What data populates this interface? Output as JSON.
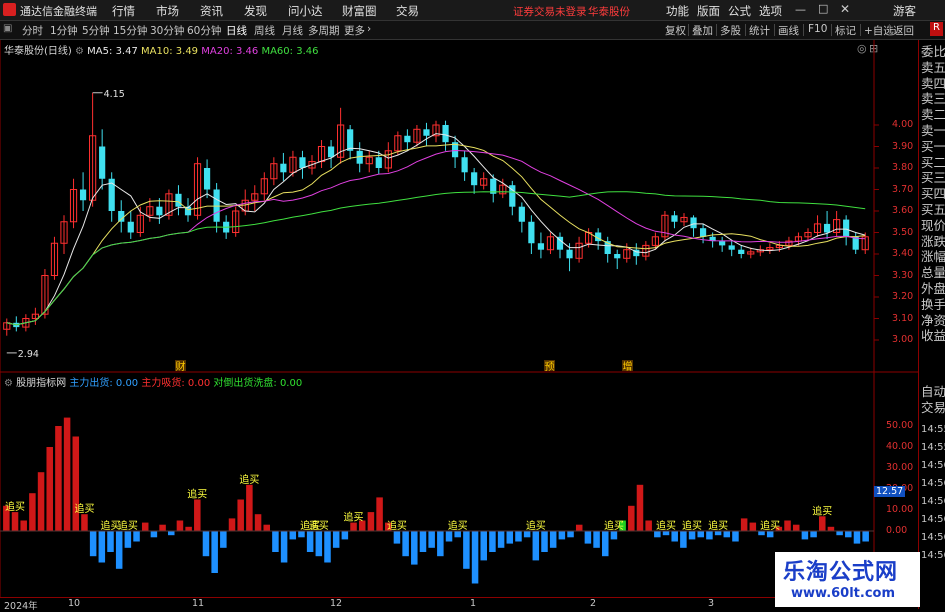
{
  "menubar": {
    "app_title": "通达信金融终端",
    "items": [
      "行情",
      "市场",
      "资讯",
      "发现",
      "问小达",
      "财富圈",
      "交易"
    ],
    "warning": "证券交易未登录",
    "broker": "华泰股份",
    "right_items": [
      "功能",
      "版面",
      "公式",
      "选项"
    ],
    "guest": "游客",
    "window_controls": [
      "minimize-icon",
      "maximize-icon",
      "close-icon"
    ]
  },
  "toolbar": {
    "periods": [
      "分时",
      "1分钟",
      "5分钟",
      "15分钟",
      "30分钟",
      "60分钟",
      "日线",
      "周线",
      "月线",
      "多周期",
      "更多"
    ],
    "active_period": "日线",
    "right_buttons": [
      "复权",
      "叠加",
      "多股",
      "统计",
      "画线",
      "F10",
      "标记",
      "+自选",
      "返回"
    ]
  },
  "main_chart": {
    "stock_label": "华泰股份(日线)",
    "ma": [
      {
        "name": "MA5",
        "value": "3.47",
        "color": "#e8e8e8"
      },
      {
        "name": "MA10",
        "value": "3.49",
        "color": "#e8e060"
      },
      {
        "name": "MA20",
        "value": "3.46",
        "color": "#e040e0"
      },
      {
        "name": "MA60",
        "value": "3.46",
        "color": "#40e040"
      }
    ],
    "high_label": "4.15",
    "low_label": "2.94",
    "event_labels": [
      "财",
      "预",
      "增"
    ],
    "price_axis": [
      "4.00",
      "3.90",
      "3.80",
      "3.70",
      "3.60",
      "3.50",
      "3.40",
      "3.30",
      "3.20",
      "3.10",
      "3.00"
    ]
  },
  "indicator": {
    "name": "股朋指标网",
    "lines": [
      {
        "label": "主力出货:",
        "value": "0.00",
        "color": "#30a0ff"
      },
      {
        "label": "主力吸货:",
        "value": "0.00",
        "color": "#ff3030"
      },
      {
        "label": "对倒出货洗盘:",
        "value": "0.00",
        "color": "#30e030"
      }
    ],
    "axis": [
      "50.00",
      "40.00",
      "30.00",
      "20.00",
      "10.00",
      "0.00"
    ],
    "signal_text": "追买",
    "badge": "12.57"
  },
  "date_axis": [
    "2024年",
    "10",
    "11",
    "12",
    "1",
    "2",
    "3"
  ],
  "right_panel": {
    "items": [
      "委比",
      "卖五",
      "卖四",
      "卖三",
      "卖二",
      "卖一",
      "买一",
      "买二",
      "买三",
      "买四",
      "买五",
      "现价",
      "涨跌",
      "涨幅",
      "总量",
      "外盘",
      "换手",
      "净资",
      "收益"
    ],
    "auto_trade": [
      "自动",
      "交易"
    ],
    "times": [
      "14:55",
      "14:55",
      "14:56",
      "14:56",
      "14:56",
      "14:56",
      "14:56",
      "14:56"
    ],
    "r_badge": "R"
  },
  "watermark": {
    "title": "乐淘公式网",
    "url": "www.60lt.com"
  },
  "chart_data": {
    "type": "candlestick",
    "ylim": [
      2.9,
      4.2
    ],
    "candles": [
      [
        3.05,
        3.08,
        3.02,
        3.1
      ],
      [
        3.08,
        3.06,
        3.04,
        3.11
      ],
      [
        3.06,
        3.1,
        3.04,
        3.12
      ],
      [
        3.1,
        3.12,
        3.07,
        3.15
      ],
      [
        3.12,
        3.3,
        3.1,
        3.33
      ],
      [
        3.3,
        3.45,
        3.28,
        3.48
      ],
      [
        3.45,
        3.55,
        3.4,
        3.58
      ],
      [
        3.55,
        3.7,
        3.52,
        3.75
      ],
      [
        3.7,
        3.65,
        3.6,
        3.78
      ],
      [
        3.65,
        3.95,
        3.62,
        4.15
      ],
      [
        3.9,
        3.75,
        3.7,
        3.98
      ],
      [
        3.75,
        3.6,
        3.55,
        3.78
      ],
      [
        3.6,
        3.55,
        3.5,
        3.65
      ],
      [
        3.55,
        3.5,
        3.47,
        3.6
      ],
      [
        3.5,
        3.58,
        3.48,
        3.62
      ],
      [
        3.58,
        3.62,
        3.55,
        3.66
      ],
      [
        3.62,
        3.58,
        3.54,
        3.66
      ],
      [
        3.58,
        3.68,
        3.56,
        3.7
      ],
      [
        3.68,
        3.62,
        3.58,
        3.72
      ],
      [
        3.62,
        3.58,
        3.55,
        3.66
      ],
      [
        3.58,
        3.82,
        3.56,
        3.85
      ],
      [
        3.8,
        3.7,
        3.66,
        3.84
      ],
      [
        3.7,
        3.55,
        3.5,
        3.73
      ],
      [
        3.55,
        3.5,
        3.47,
        3.58
      ],
      [
        3.5,
        3.6,
        3.48,
        3.62
      ],
      [
        3.6,
        3.65,
        3.58,
        3.7
      ],
      [
        3.65,
        3.68,
        3.6,
        3.72
      ],
      [
        3.68,
        3.75,
        3.65,
        3.78
      ],
      [
        3.75,
        3.82,
        3.72,
        3.85
      ],
      [
        3.82,
        3.78,
        3.74,
        3.87
      ],
      [
        3.78,
        3.85,
        3.76,
        3.88
      ],
      [
        3.85,
        3.8,
        3.75,
        3.88
      ],
      [
        3.8,
        3.83,
        3.77,
        3.86
      ],
      [
        3.83,
        3.9,
        3.8,
        3.93
      ],
      [
        3.9,
        3.85,
        3.8,
        3.93
      ],
      [
        3.85,
        4.0,
        3.82,
        4.08
      ],
      [
        3.98,
        3.88,
        3.84,
        4.0
      ],
      [
        3.88,
        3.82,
        3.78,
        3.92
      ],
      [
        3.82,
        3.85,
        3.78,
        3.88
      ],
      [
        3.85,
        3.8,
        3.77,
        3.88
      ],
      [
        3.8,
        3.88,
        3.78,
        3.92
      ],
      [
        3.88,
        3.95,
        3.86,
        3.97
      ],
      [
        3.95,
        3.92,
        3.88,
        3.98
      ],
      [
        3.92,
        3.98,
        3.9,
        4.0
      ],
      [
        3.98,
        3.95,
        3.9,
        4.01
      ],
      [
        3.95,
        4.0,
        3.92,
        4.02
      ],
      [
        4.0,
        3.92,
        3.88,
        4.02
      ],
      [
        3.92,
        3.85,
        3.8,
        3.95
      ],
      [
        3.85,
        3.78,
        3.74,
        3.88
      ],
      [
        3.78,
        3.72,
        3.68,
        3.8
      ],
      [
        3.72,
        3.75,
        3.7,
        3.78
      ],
      [
        3.75,
        3.68,
        3.64,
        3.77
      ],
      [
        3.68,
        3.72,
        3.66,
        3.75
      ],
      [
        3.72,
        3.62,
        3.58,
        3.74
      ],
      [
        3.62,
        3.55,
        3.5,
        3.64
      ],
      [
        3.55,
        3.45,
        3.4,
        3.58
      ],
      [
        3.45,
        3.42,
        3.38,
        3.5
      ],
      [
        3.42,
        3.48,
        3.4,
        3.5
      ],
      [
        3.48,
        3.42,
        3.38,
        3.5
      ],
      [
        3.42,
        3.38,
        3.32,
        3.45
      ],
      [
        3.38,
        3.45,
        3.36,
        3.48
      ],
      [
        3.45,
        3.5,
        3.43,
        3.52
      ],
      [
        3.5,
        3.46,
        3.42,
        3.52
      ],
      [
        3.46,
        3.4,
        3.36,
        3.48
      ],
      [
        3.4,
        3.38,
        3.33,
        3.42
      ],
      [
        3.38,
        3.42,
        3.36,
        3.45
      ],
      [
        3.42,
        3.39,
        3.35,
        3.45
      ],
      [
        3.39,
        3.44,
        3.37,
        3.46
      ],
      [
        3.44,
        3.48,
        3.42,
        3.5
      ],
      [
        3.48,
        3.58,
        3.46,
        3.6
      ],
      [
        3.58,
        3.55,
        3.52,
        3.6
      ],
      [
        3.55,
        3.57,
        3.53,
        3.59
      ],
      [
        3.57,
        3.52,
        3.48,
        3.58
      ],
      [
        3.52,
        3.48,
        3.45,
        3.54
      ],
      [
        3.48,
        3.46,
        3.43,
        3.5
      ],
      [
        3.46,
        3.44,
        3.41,
        3.48
      ],
      [
        3.44,
        3.42,
        3.39,
        3.46
      ],
      [
        3.42,
        3.4,
        3.38,
        3.44
      ],
      [
        3.4,
        3.41,
        3.38,
        3.43
      ],
      [
        3.41,
        3.42,
        3.39,
        3.44
      ],
      [
        3.42,
        3.43,
        3.4,
        3.45
      ],
      [
        3.43,
        3.44,
        3.41,
        3.46
      ],
      [
        3.44,
        3.46,
        3.42,
        3.48
      ],
      [
        3.46,
        3.48,
        3.44,
        3.5
      ],
      [
        3.48,
        3.5,
        3.46,
        3.52
      ],
      [
        3.5,
        3.54,
        3.48,
        3.58
      ],
      [
        3.54,
        3.5,
        3.47,
        3.6
      ],
      [
        3.5,
        3.56,
        3.48,
        3.6
      ],
      [
        3.56,
        3.48,
        3.44,
        3.58
      ],
      [
        3.48,
        3.42,
        3.4,
        3.5
      ],
      [
        3.42,
        3.48,
        3.4,
        3.5
      ]
    ],
    "indicator_bars": [
      12,
      9,
      5,
      18,
      28,
      40,
      50,
      54,
      45,
      8,
      -12,
      -15,
      -10,
      -18,
      -8,
      -5,
      4,
      -3,
      3,
      -2,
      5,
      2,
      15,
      -12,
      -20,
      -8,
      6,
      15,
      22,
      8,
      3,
      -10,
      -15,
      -4,
      -3,
      -10,
      -12,
      -15,
      -8,
      -4,
      4,
      5,
      9,
      16,
      4,
      -6,
      -12,
      -16,
      -10,
      -8,
      -12,
      -5,
      -3,
      -18,
      -25,
      -14,
      -10,
      -8,
      -6,
      -5,
      -3,
      -14,
      -10,
      -8,
      -4,
      -3,
      3,
      -6,
      -8,
      -12,
      -4,
      5,
      12,
      22,
      5,
      -3,
      -2,
      -5,
      -8,
      -4,
      -3,
      -4,
      -2,
      -3,
      -5,
      6,
      4,
      -2,
      -3,
      2,
      5,
      3,
      -4,
      -3,
      7,
      2,
      -2,
      -3,
      -6,
      -5
    ],
    "signal_positions": [
      1,
      9,
      12,
      14,
      22,
      28,
      35,
      36,
      40,
      45,
      52,
      61,
      70,
      76,
      79,
      82,
      88,
      94
    ]
  }
}
